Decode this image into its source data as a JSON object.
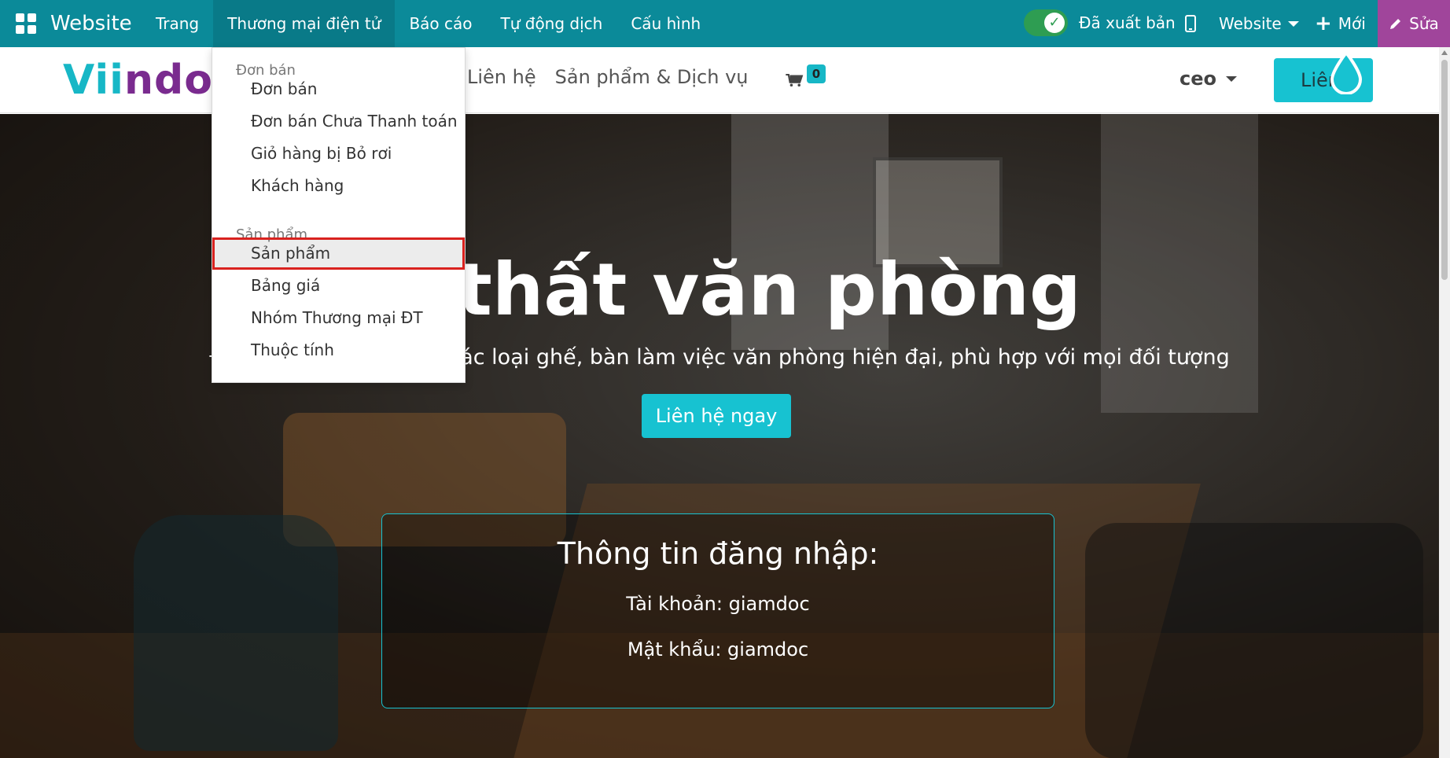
{
  "admin_bar": {
    "app_name": "Website",
    "menu": [
      {
        "label": "Trang",
        "active": false
      },
      {
        "label": "Thương mại điện tử",
        "active": true
      },
      {
        "label": "Báo cáo",
        "active": false
      },
      {
        "label": "Tự động dịch",
        "active": false
      },
      {
        "label": "Cấu hình",
        "active": false
      }
    ],
    "published_label": "Đã xuất bản",
    "published": true,
    "website_switch": "Website",
    "new_label": "Mới",
    "edit_label": "Sửa",
    "colors": {
      "bar": "#0b8a99",
      "edit": "#a0459b",
      "toggle": "#2e9d52"
    }
  },
  "dropdown": {
    "sections": [
      {
        "header": "Đơn bán",
        "items": [
          "Đơn bán",
          "Đơn bán Chưa Thanh toán",
          "Giỏ hàng bị Bỏ rơi",
          "Khách hàng"
        ]
      },
      {
        "header": "Sản phẩm",
        "items": [
          "Sản phẩm",
          "Bảng giá",
          "Nhóm Thương mại ĐT",
          "Thuộc tính"
        ]
      }
    ],
    "highlighted_item": "Sản phẩm"
  },
  "site_header": {
    "logo_part1": "Vii",
    "logo_part2": "ndoo",
    "nav": [
      "Liên hệ",
      "Sản phẩm & Dịch vụ"
    ],
    "cart_count": "0",
    "user": "ceo",
    "contact_button": "Liên",
    "colors": {
      "accent": "#17c2d1",
      "logo_purple": "#7a2b8f"
    }
  },
  "hero": {
    "title": "ội thất văn phòng",
    "subtitle": "Đ                                 các loại ghế, bàn làm việc văn phòng hiện đại, phù hợp với mọi đối tượng",
    "cta": "Liên hệ ngay",
    "login_box": {
      "title": "Thông tin đăng nhập:",
      "username": "Tài khoản: giamdoc",
      "password": "Mật khẩu: giamdoc"
    }
  }
}
